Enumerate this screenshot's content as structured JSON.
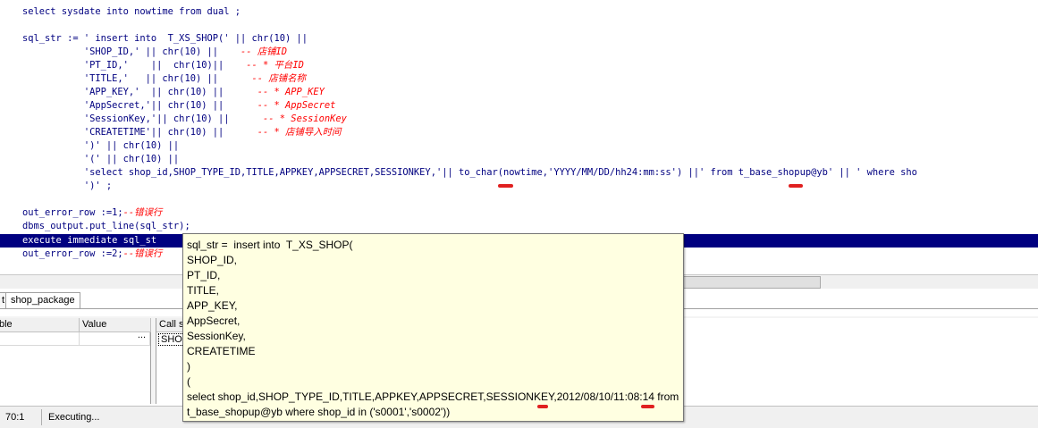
{
  "editor": {
    "lines": [
      {
        "code": "    select sysdate into nowtime from dual ;",
        "comment": ""
      },
      {
        "code": "",
        "comment": ""
      },
      {
        "code": "    sql_str := ' insert into  T_XS_SHOP(' || chr(10) ||",
        "comment": ""
      },
      {
        "code": "               'SHOP_ID,' || chr(10) ||    ",
        "comment": "-- 店铺ID"
      },
      {
        "code": "               'PT_ID,'    ||  chr(10)||    ",
        "comment": "-- * 平台ID"
      },
      {
        "code": "               'TITLE,'   || chr(10) ||      ",
        "comment": "-- 店铺名称"
      },
      {
        "code": "               'APP_KEY,'  || chr(10) ||      ",
        "comment": "-- * APP_KEY"
      },
      {
        "code": "               'AppSecret,'|| chr(10) ||      ",
        "comment": "-- * AppSecret"
      },
      {
        "code": "               'SessionKey,'|| chr(10) ||      ",
        "comment": "-- * SessionKey"
      },
      {
        "code": "               'CREATETIME'|| chr(10) ||      ",
        "comment": "-- * 店铺导入时间"
      },
      {
        "code": "               ')' || chr(10) ||",
        "comment": ""
      },
      {
        "code": "               '(' || chr(10) ||",
        "comment": ""
      },
      {
        "code": "               'select shop_id,SHOP_TYPE_ID,TITLE,APPKEY,APPSECRET,SESSIONKEY,'|| to_char(nowtime,'YYYY/MM/DD/hh24:mm:ss') ||' from t_base_shopup@yb' || ' where sho",
        "comment": ""
      },
      {
        "code": "               ')' ;",
        "comment": ""
      },
      {
        "code": "",
        "comment": ""
      },
      {
        "code": "    out_error_row :=1;",
        "comment": "--错误行"
      },
      {
        "code": "    dbms_output.put_line(sql_str);",
        "comment": ""
      },
      {
        "code": "    execute immediate sql_st",
        "comment": ""
      },
      {
        "code": "    out_error_row :=2;",
        "comment": "--错误行"
      }
    ]
  },
  "tabs": [
    {
      "label": "t"
    },
    {
      "label": "shop_package"
    }
  ],
  "variables_grid": {
    "headers": [
      "ble",
      "Value"
    ],
    "row_button": "..."
  },
  "call_stack": {
    "header": "Call st",
    "row": "SHOP"
  },
  "status_bar": {
    "position": "70:1",
    "state": "Executing..."
  },
  "tooltip": {
    "lines": [
      "sql_str =  insert into  T_XS_SHOP(",
      "SHOP_ID,",
      "PT_ID,",
      "TITLE,",
      "APP_KEY,",
      "AppSecret,",
      "SessionKey,",
      "CREATETIME",
      ")",
      "(",
      "select shop_id,SHOP_TYPE_ID,TITLE,APPKEY,APPSECRET,SESSIONKEY,2012/08/10/11:08:14 from",
      "t_base_shopup@yb where shop_id in ('s0001','s0002'))"
    ]
  },
  "colors": {
    "keyword": "#000080",
    "comment": "#ff0000",
    "selection": "#000080",
    "tooltip_bg": "#ffffe1",
    "annotation_mark": "#e02020"
  }
}
